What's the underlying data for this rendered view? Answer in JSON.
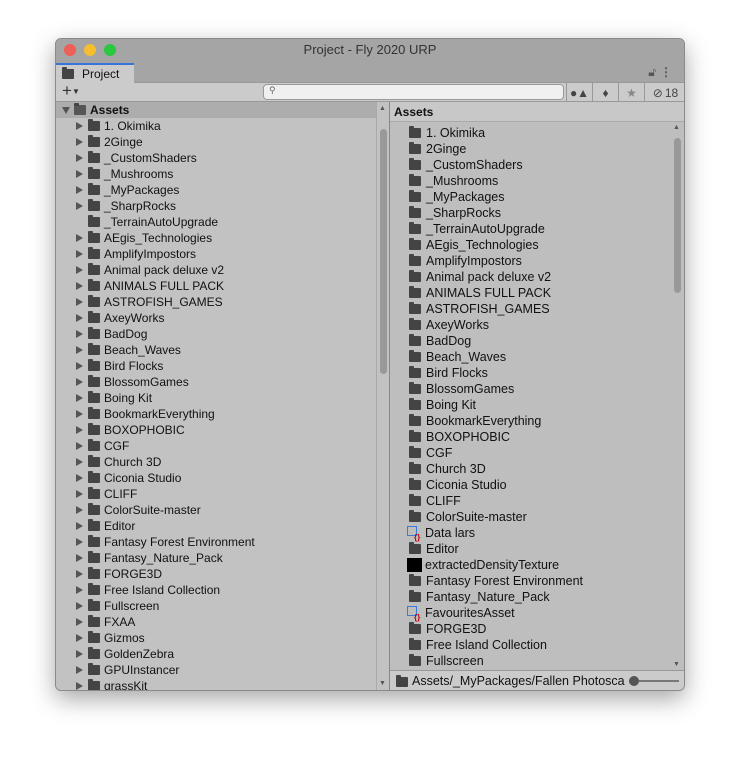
{
  "window": {
    "title": "Project - Fly 2020 URP",
    "tab_label": "Project"
  },
  "toolbar": {
    "hidden_count": "18"
  },
  "tree": {
    "root": "Assets",
    "items": [
      {
        "label": "1. Okimika",
        "expandable": true
      },
      {
        "label": "2Ginge",
        "expandable": true
      },
      {
        "label": "_CustomShaders",
        "expandable": true
      },
      {
        "label": "_Mushrooms",
        "expandable": true
      },
      {
        "label": "_MyPackages",
        "expandable": true
      },
      {
        "label": "_SharpRocks",
        "expandable": true
      },
      {
        "label": "_TerrainAutoUpgrade",
        "expandable": false
      },
      {
        "label": "AEgis_Technologies",
        "expandable": true
      },
      {
        "label": "AmplifyImpostors",
        "expandable": true
      },
      {
        "label": "Animal pack deluxe v2",
        "expandable": true
      },
      {
        "label": "ANIMALS FULL PACK",
        "expandable": true
      },
      {
        "label": "ASTROFISH_GAMES",
        "expandable": true
      },
      {
        "label": "AxeyWorks",
        "expandable": true
      },
      {
        "label": "BadDog",
        "expandable": true
      },
      {
        "label": "Beach_Waves",
        "expandable": true
      },
      {
        "label": "Bird Flocks",
        "expandable": true
      },
      {
        "label": "BlossomGames",
        "expandable": true
      },
      {
        "label": "Boing Kit",
        "expandable": true
      },
      {
        "label": "BookmarkEverything",
        "expandable": true
      },
      {
        "label": "BOXOPHOBIC",
        "expandable": true
      },
      {
        "label": "CGF",
        "expandable": true
      },
      {
        "label": "Church 3D",
        "expandable": true
      },
      {
        "label": "Ciconia Studio",
        "expandable": true
      },
      {
        "label": "CLIFF",
        "expandable": true
      },
      {
        "label": "ColorSuite-master",
        "expandable": true
      },
      {
        "label": "Editor",
        "expandable": true
      },
      {
        "label": "Fantasy Forest Environment",
        "expandable": true
      },
      {
        "label": "Fantasy_Nature_Pack",
        "expandable": true
      },
      {
        "label": "FORGE3D",
        "expandable": true
      },
      {
        "label": "Free Island Collection",
        "expandable": true
      },
      {
        "label": "Fullscreen",
        "expandable": true
      },
      {
        "label": "FXAA",
        "expandable": true
      },
      {
        "label": "Gizmos",
        "expandable": true
      },
      {
        "label": "GoldenZebra",
        "expandable": true
      },
      {
        "label": "GPUInstancer",
        "expandable": true
      },
      {
        "label": "grassKit",
        "expandable": true
      }
    ]
  },
  "content": {
    "header": "Assets",
    "items": [
      {
        "label": "1. Okimika",
        "icon": "folder"
      },
      {
        "label": "2Ginge",
        "icon": "folder"
      },
      {
        "label": "_CustomShaders",
        "icon": "folder"
      },
      {
        "label": "_Mushrooms",
        "icon": "folder"
      },
      {
        "label": "_MyPackages",
        "icon": "folder"
      },
      {
        "label": "_SharpRocks",
        "icon": "folder"
      },
      {
        "label": "_TerrainAutoUpgrade",
        "icon": "folder"
      },
      {
        "label": "AEgis_Technologies",
        "icon": "folder"
      },
      {
        "label": "AmplifyImpostors",
        "icon": "folder"
      },
      {
        "label": "Animal pack deluxe v2",
        "icon": "folder"
      },
      {
        "label": "ANIMALS FULL PACK",
        "icon": "folder"
      },
      {
        "label": "ASTROFISH_GAMES",
        "icon": "folder"
      },
      {
        "label": "AxeyWorks",
        "icon": "folder"
      },
      {
        "label": "BadDog",
        "icon": "folder"
      },
      {
        "label": "Beach_Waves",
        "icon": "folder"
      },
      {
        "label": "Bird Flocks",
        "icon": "folder"
      },
      {
        "label": "BlossomGames",
        "icon": "folder"
      },
      {
        "label": "Boing Kit",
        "icon": "folder"
      },
      {
        "label": "BookmarkEverything",
        "icon": "folder"
      },
      {
        "label": "BOXOPHOBIC",
        "icon": "folder"
      },
      {
        "label": "CGF",
        "icon": "folder"
      },
      {
        "label": "Church 3D",
        "icon": "folder"
      },
      {
        "label": "Ciconia Studio",
        "icon": "folder"
      },
      {
        "label": "CLIFF",
        "icon": "folder"
      },
      {
        "label": "ColorSuite-master",
        "icon": "folder"
      },
      {
        "label": "Data lars",
        "icon": "scriptable"
      },
      {
        "label": "Editor",
        "icon": "folder"
      },
      {
        "label": "extractedDensityTexture",
        "icon": "texture"
      },
      {
        "label": "Fantasy Forest Environment",
        "icon": "folder"
      },
      {
        "label": "Fantasy_Nature_Pack",
        "icon": "folder"
      },
      {
        "label": "FavouritesAsset",
        "icon": "scriptable"
      },
      {
        "label": "FORGE3D",
        "icon": "folder"
      },
      {
        "label": "Free Island Collection",
        "icon": "folder"
      },
      {
        "label": "Fullscreen",
        "icon": "folder"
      }
    ]
  },
  "status": {
    "path": "Assets/_MyPackages/Fallen Photosca"
  }
}
